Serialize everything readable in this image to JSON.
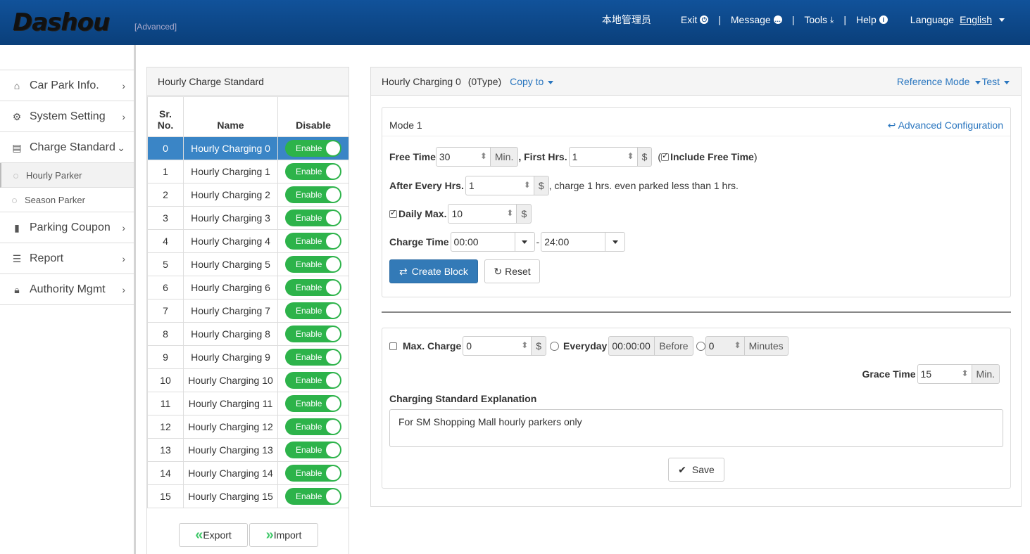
{
  "header": {
    "logo": "Dashou",
    "edition": "[Advanced]",
    "user": "本地管理员",
    "exit": "Exit",
    "message": "Message",
    "tools": "Tools",
    "help": "Help",
    "language_label": "Language",
    "language_value": "English"
  },
  "sidebar": {
    "items": [
      {
        "label": "Car Park Info.",
        "icon": "home-icon"
      },
      {
        "label": "System Setting",
        "icon": "gear-icon"
      },
      {
        "label": "Charge Standard",
        "icon": "book-icon"
      },
      {
        "label": "Parking Coupon",
        "icon": "bookmark-icon"
      },
      {
        "label": "Report",
        "icon": "list-icon"
      },
      {
        "label": "Authority Mgmt",
        "icon": "lock-icon"
      }
    ],
    "sub_items": [
      "Hourly Parker",
      "Season Parker"
    ]
  },
  "left_panel": {
    "title": "Hourly Charge Standard",
    "columns": [
      "Sr. No.",
      "Name",
      "Disable"
    ],
    "toggle_label": "Enable",
    "rows": [
      {
        "no": "0",
        "name": "Hourly Charging 0"
      },
      {
        "no": "1",
        "name": "Hourly Charging 1"
      },
      {
        "no": "2",
        "name": "Hourly Charging 2"
      },
      {
        "no": "3",
        "name": "Hourly Charging 3"
      },
      {
        "no": "4",
        "name": "Hourly Charging 4"
      },
      {
        "no": "5",
        "name": "Hourly Charging 5"
      },
      {
        "no": "6",
        "name": "Hourly Charging 6"
      },
      {
        "no": "7",
        "name": "Hourly Charging 7"
      },
      {
        "no": "8",
        "name": "Hourly Charging 8"
      },
      {
        "no": "9",
        "name": "Hourly Charging 9"
      },
      {
        "no": "10",
        "name": "Hourly Charging 10"
      },
      {
        "no": "11",
        "name": "Hourly Charging 11"
      },
      {
        "no": "12",
        "name": "Hourly Charging 12"
      },
      {
        "no": "13",
        "name": "Hourly Charging 13"
      },
      {
        "no": "14",
        "name": "Hourly Charging 14"
      },
      {
        "no": "15",
        "name": "Hourly Charging 15"
      }
    ],
    "export": "Export",
    "import": "Import"
  },
  "right_panel": {
    "title": "Hourly Charging 0",
    "type": "(0Type)",
    "copy_to": "Copy to",
    "reference_mode": "Reference Mode",
    "test": "Test",
    "mode": {
      "title": "Mode 1",
      "advanced": "Advanced Configuration",
      "free_time_label": "Free Time",
      "free_time_value": "30",
      "min_unit": "Min.",
      "first_hrs_label": ", First Hrs.",
      "first_hrs_value": "1",
      "currency": "$",
      "include_free_time": "Include Free Time",
      "paren_open": "(",
      "paren_close": ")",
      "after_every_label": "After Every Hrs.",
      "after_every_value": "1",
      "after_every_note": ", charge 1 hrs. even parked less than 1 hrs.",
      "daily_max_label": "Daily Max.",
      "daily_max_value": "10",
      "charge_time_label": "Charge Time",
      "charge_time_from": "00:00",
      "charge_time_to": "24:00",
      "dash": "-",
      "create_block": "Create Block",
      "reset": "Reset"
    },
    "extra": {
      "max_charge_label": "Max. Charge",
      "max_charge_value": "0",
      "everyday_label": "Everyday",
      "everyday_time": "00:00:00",
      "before": "Before",
      "minutes_value": "0",
      "minutes": "Minutes",
      "grace_time_label": "Grace Time",
      "grace_time_value": "15",
      "explanation_label": "Charging Standard Explanation",
      "explanation_value": "For SM Shopping Mall hourly parkers only",
      "save": "Save"
    }
  }
}
